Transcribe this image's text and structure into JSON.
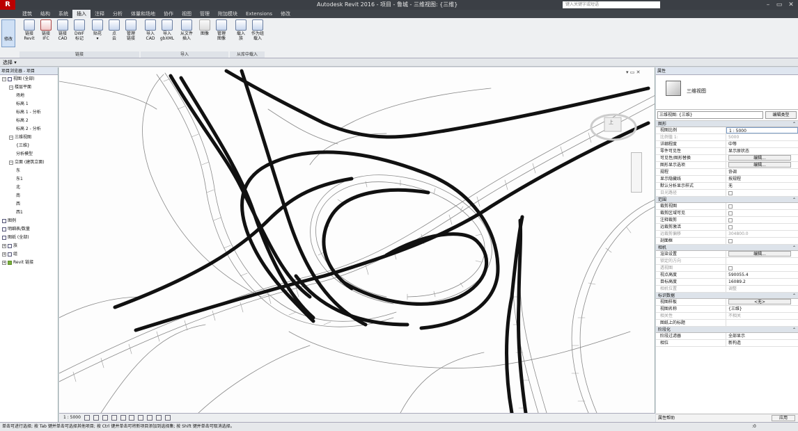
{
  "titlebar": {
    "logo": "R",
    "title": "Autodesk Revit 2016 -  项目 - 鲁城 - 三维视图: {三维}",
    "search_placeholder": "键入关键字或短语"
  },
  "tabs": [
    "建筑",
    "结构",
    "系统",
    "插入",
    "注释",
    "分析",
    "体量和场地",
    "协作",
    "视图",
    "管理",
    "附加模块",
    "Extensions",
    "修改"
  ],
  "ribbon": {
    "select_label": "修改",
    "buttons": [
      {
        "label": "链接\nRevit"
      },
      {
        "label": "链接\nIFC"
      },
      {
        "label": "链接\nCAD"
      },
      {
        "label": "DWF\n标记"
      },
      {
        "label": "贴花\n▾"
      },
      {
        "label": "点\n云"
      },
      {
        "label": "管理\n链接"
      },
      {
        "label": "导入\nCAD"
      },
      {
        "label": "导入\ngbXML"
      },
      {
        "label": "从文件\n插入"
      },
      {
        "label": "图像"
      },
      {
        "label": "管理\n图像"
      },
      {
        "label": "载入\n族"
      },
      {
        "label": "作为组\n载入"
      }
    ],
    "groups": [
      "链接",
      "导入",
      "从库中载入"
    ],
    "options_label": "选择 ▾"
  },
  "browser": {
    "title": "项目浏览器 - 项目",
    "items": [
      {
        "label": "视图 (全部)",
        "level": 0,
        "toggle": "−",
        "icon": "views"
      },
      {
        "label": "楼层平面",
        "level": 1,
        "toggle": "−",
        "icon": "none"
      },
      {
        "label": "场地",
        "level": 2,
        "toggle": "",
        "icon": "none"
      },
      {
        "label": "标高 1",
        "level": 2,
        "toggle": "",
        "icon": "none"
      },
      {
        "label": "标高 1 - 分析",
        "level": 2,
        "toggle": "",
        "icon": "none"
      },
      {
        "label": "标高 2",
        "level": 2,
        "toggle": "",
        "icon": "none"
      },
      {
        "label": "标高 2 - 分析",
        "level": 2,
        "toggle": "",
        "icon": "none"
      },
      {
        "label": "三维视图",
        "level": 1,
        "toggle": "−",
        "icon": "none"
      },
      {
        "label": "{三维}",
        "level": 2,
        "toggle": "",
        "icon": "none"
      },
      {
        "label": "分析模型",
        "level": 2,
        "toggle": "",
        "icon": "none"
      },
      {
        "label": "立面 (建筑立面)",
        "level": 1,
        "toggle": "−",
        "icon": "none"
      },
      {
        "label": "东",
        "level": 2,
        "toggle": "",
        "icon": "none"
      },
      {
        "label": "东1",
        "level": 2,
        "toggle": "",
        "icon": "none"
      },
      {
        "label": "北",
        "level": 2,
        "toggle": "",
        "icon": "none"
      },
      {
        "label": "南",
        "level": 2,
        "toggle": "",
        "icon": "none"
      },
      {
        "label": "西",
        "level": 2,
        "toggle": "",
        "icon": "none"
      },
      {
        "label": "西1",
        "level": 2,
        "toggle": "",
        "icon": "none"
      },
      {
        "label": "图例",
        "level": 0,
        "toggle": "",
        "icon": "sheet"
      },
      {
        "label": "明细表/数量",
        "level": 0,
        "toggle": "",
        "icon": "sheet"
      },
      {
        "label": "图纸 (全部)",
        "level": 0,
        "toggle": "",
        "icon": "sheet"
      },
      {
        "label": "族",
        "level": 0,
        "toggle": "+",
        "icon": "sheet"
      },
      {
        "label": "组",
        "level": 0,
        "toggle": "+",
        "icon": "sheet"
      },
      {
        "label": "Revit 链接",
        "level": 0,
        "toggle": "+",
        "icon": "link"
      }
    ]
  },
  "canvas": {
    "viewcube_label": "上",
    "window_controls": "▾ ▭ ✕"
  },
  "viewbar": {
    "scale": "1 : 5000"
  },
  "properties": {
    "title": "属性",
    "type_name": "三维视图",
    "filter": "三维视图: {三维}",
    "edit_type": "编辑类型",
    "apply": "应用",
    "help_link": "属性帮助",
    "sections": [
      {
        "name": "图形",
        "rows": [
          {
            "n": "视图比例",
            "v": "1 : 5000",
            "kind": "input"
          },
          {
            "n": "比例值 1:",
            "v": "5000",
            "kind": "dim"
          },
          {
            "n": "详细程度",
            "v": "中等",
            "kind": "text"
          },
          {
            "n": "零件可见性",
            "v": "显示原状态",
            "kind": "text"
          },
          {
            "n": "可见性/图形替换",
            "v": "编辑...",
            "kind": "btn"
          },
          {
            "n": "图形显示选项",
            "v": "编辑...",
            "kind": "btn"
          },
          {
            "n": "规程",
            "v": "协调",
            "kind": "text"
          },
          {
            "n": "显示隐藏线",
            "v": "按规程",
            "kind": "text"
          },
          {
            "n": "默认分析显示样式",
            "v": "无",
            "kind": "text"
          },
          {
            "n": "日光路径",
            "v": "",
            "kind": "chk-dim"
          }
        ]
      },
      {
        "name": "范围",
        "rows": [
          {
            "n": "裁剪视图",
            "v": "",
            "kind": "chk"
          },
          {
            "n": "裁剪区域可见",
            "v": "",
            "kind": "chk"
          },
          {
            "n": "注释裁剪",
            "v": "",
            "kind": "chk"
          },
          {
            "n": "远裁剪激活",
            "v": "",
            "kind": "chk"
          },
          {
            "n": "远裁剪偏移",
            "v": "304800.0",
            "kind": "dim"
          },
          {
            "n": "剖面框",
            "v": "",
            "kind": "chk"
          }
        ]
      },
      {
        "name": "相机",
        "rows": [
          {
            "n": "渲染设置",
            "v": "编辑...",
            "kind": "btn"
          },
          {
            "n": "锁定的方向",
            "v": "",
            "kind": "dim"
          },
          {
            "n": "透视图",
            "v": "",
            "kind": "chk-dim"
          },
          {
            "n": "视点高度",
            "v": "590055.4",
            "kind": "text"
          },
          {
            "n": "目标高度",
            "v": "16089.2",
            "kind": "text"
          },
          {
            "n": "相机位置",
            "v": "调整",
            "kind": "dim"
          }
        ]
      },
      {
        "name": "标识数据",
        "rows": [
          {
            "n": "视图样板",
            "v": "<无>",
            "kind": "btn"
          },
          {
            "n": "视图名称",
            "v": "{三维}",
            "kind": "text"
          },
          {
            "n": "相关性",
            "v": "不相关",
            "kind": "dim"
          },
          {
            "n": "图纸上的标题",
            "v": "",
            "kind": "text"
          }
        ]
      },
      {
        "name": "阶段化",
        "rows": [
          {
            "n": "阶段过滤器",
            "v": "全部显示",
            "kind": "text"
          },
          {
            "n": "相位",
            "v": "新构造",
            "kind": "text"
          }
        ]
      }
    ]
  },
  "statusbar": {
    "text": "单击可进行选择; 按 Tab 键并单击可选择其他项目; 按 Ctrl 键并单击可将新项目添加到选择集; 按 Shift 键并单击可取消选择。",
    "zoom": ":0"
  }
}
